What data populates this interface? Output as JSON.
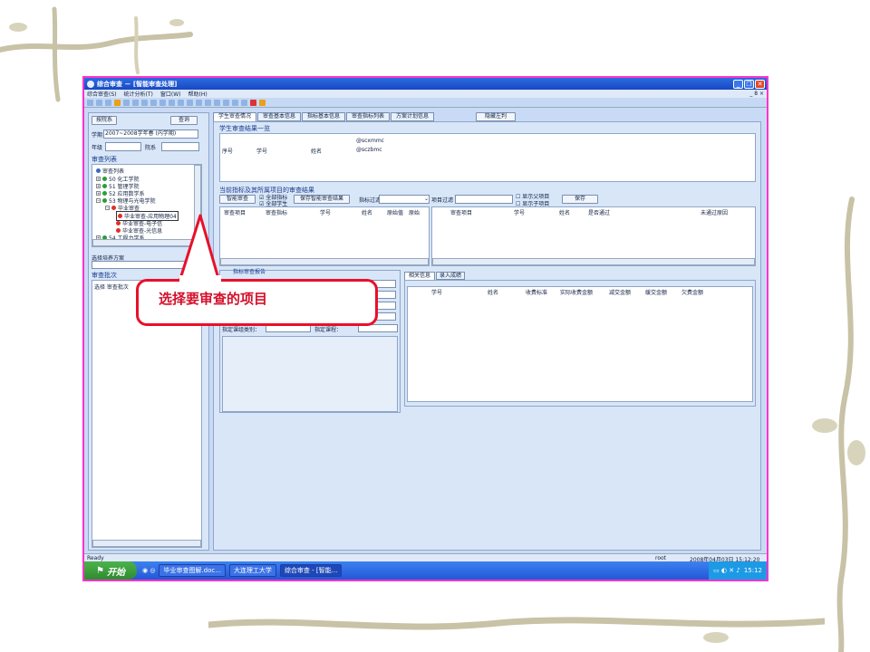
{
  "window": {
    "title": "综合审查 － [智能审查处理]"
  },
  "menu": {
    "items": [
      "综合审查(S)",
      "统计分析(T)",
      "窗口(W)",
      "帮助(H)"
    ],
    "right": "_ 8 ×"
  },
  "left": {
    "dept_button": "按院系",
    "query_button": "查询",
    "term_label": "学期",
    "term_value": "2007~2008学年春 (内学期)",
    "grade_label": "年级",
    "dept_label": "院系",
    "list_title": "审查列表",
    "tree": [
      "审查列表",
      "50 化工学院",
      "51 管理学院",
      "52 应用数学系",
      "53 物理与光电学院",
      "毕业审查",
      "毕业审查-应用物理04",
      "毕业审查-电子信",
      "毕业审查-光信息",
      "54 工程力学系"
    ],
    "plan_label": "选择培养方案",
    "batch_title": "审查批次",
    "batch_header": "选择 审查批次"
  },
  "tabs": [
    "学生审查情况",
    "审查基本信息",
    "指标基本信息",
    "审查指标列表",
    "方案计划信息"
  ],
  "hide_left_button": "隐藏左判",
  "results": {
    "title": "学生审查结果一览",
    "col_seq": "序号",
    "col_id": "学号",
    "col_name": "姓名",
    "param1": "@scxmmc",
    "param2": "@sczbmc"
  },
  "indicators": {
    "title": "当前指标及其所属项目的审查结果",
    "smart_button": "智能审查",
    "check_all_indicators": "全部指标",
    "check_all_students": "全部学生",
    "save_smart_button": "保存智能审查结果",
    "filter_indicator_label": "指标过滤",
    "filter_project_label": "项目过滤",
    "show_parent": "显示父项目",
    "show_child": "显示子项目",
    "save_button": "保存",
    "left_cols": [
      "审查项目",
      "审查指标",
      "学号",
      "姓名",
      "原始值",
      "原始"
    ],
    "right_cols": [
      "审查项目",
      "学号",
      "姓名",
      "是否通过",
      "未通过原因"
    ]
  },
  "bottom": {
    "group_title": "指标审查报告",
    "course_type_label": "指定课组类别：",
    "course_label": "指定课程：",
    "tab_related": "相关信息",
    "tab_scores": "录入成绩",
    "cols": [
      "学号",
      "姓名",
      "收费标准",
      "实际收费金额",
      "减交金额",
      "缓交金额",
      "欠费金额"
    ]
  },
  "status": {
    "ready": "Ready",
    "user": "root",
    "datetime": "2008年04月03日 15:12:20"
  },
  "taskbar": {
    "start": "开始",
    "tasks": [
      "毕业审查图解.doc...",
      "大连理工大学",
      "综合审查 - [智能..."
    ],
    "clock": "15:12"
  },
  "annotation": {
    "text": "选择要审查的项目"
  },
  "colors": {
    "accent_border": "#ff33cc",
    "callout_red": "#e8102a",
    "window_bg": "#c8daf6",
    "titlebar": "#1848c4"
  }
}
